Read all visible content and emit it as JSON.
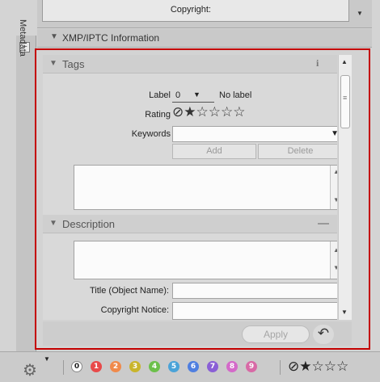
{
  "top": {
    "copyright_label": "Copyright:"
  },
  "sidebar": {
    "tab_label": "Metadata"
  },
  "xmp": {
    "header_title": "XMP/IPTC Information"
  },
  "tags": {
    "title": "Tags",
    "info_icon": "i",
    "label_label": "Label",
    "label_value": "0",
    "label_text": "No label",
    "rating_label": "Rating",
    "rating_value": "1 of 5 stars",
    "keywords_label": "Keywords",
    "keywords_value": "",
    "add_label": "Add",
    "delete_label": "Delete"
  },
  "description": {
    "title": "Description",
    "title_object_label": "Title (Object Name):",
    "title_object_value": "",
    "copyright_notice_label": "Copyright Notice:",
    "copyright_notice_value": ""
  },
  "actions": {
    "apply_label": "Apply"
  },
  "bottom": {
    "color_labels": [
      {
        "num": "0",
        "color": "#ffffff"
      },
      {
        "num": "1",
        "color": "#e84a4a"
      },
      {
        "num": "2",
        "color": "#f08a4b"
      },
      {
        "num": "3",
        "color": "#c9b52b"
      },
      {
        "num": "4",
        "color": "#6cc04a"
      },
      {
        "num": "5",
        "color": "#4aa3d8"
      },
      {
        "num": "6",
        "color": "#4f7fe0"
      },
      {
        "num": "7",
        "color": "#8a5fd6"
      },
      {
        "num": "8",
        "color": "#d46ac9"
      },
      {
        "num": "9",
        "color": "#d86aa6"
      }
    ],
    "rating_value": "1 of 5 stars"
  },
  "colors": {
    "highlight_frame": "#c40000"
  },
  "icons": [
    "gear-icon",
    "info-icon",
    "revert-icon",
    "no-rating-icon",
    "star-icon",
    "dropdown-arrow-icon",
    "collapse-icon"
  ]
}
